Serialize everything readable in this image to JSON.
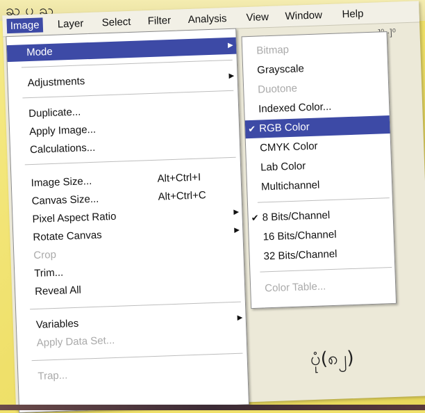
{
  "menubar": {
    "items": [
      "Image",
      "Layer",
      "Select",
      "Filter",
      "Analysis",
      "View",
      "Window",
      "Help"
    ]
  },
  "toolbar": {
    "glyphs": "]⁰ ·]⁰"
  },
  "image_menu": {
    "items": [
      {
        "label": "Mode",
        "submenu": true,
        "highlighted": true
      },
      {
        "label": "Adjustments",
        "submenu": true
      },
      {
        "label": "Duplicate..."
      },
      {
        "label": "Apply Image..."
      },
      {
        "label": "Calculations..."
      },
      {
        "label": "Image Size...",
        "shortcut": "Alt+Ctrl+I"
      },
      {
        "label": "Canvas Size...",
        "shortcut": "Alt+Ctrl+C"
      },
      {
        "label": "Pixel Aspect Ratio",
        "submenu": true
      },
      {
        "label": "Rotate Canvas",
        "submenu": true
      },
      {
        "label": "Crop",
        "disabled": true
      },
      {
        "label": "Trim..."
      },
      {
        "label": "Reveal All"
      },
      {
        "label": "Variables",
        "submenu": true
      },
      {
        "label": "Apply Data Set...",
        "disabled": true
      },
      {
        "label": "Trap...",
        "disabled": true
      }
    ]
  },
  "mode_menu": {
    "items": [
      {
        "label": "Bitmap",
        "disabled": true
      },
      {
        "label": "Grayscale"
      },
      {
        "label": "Duotone",
        "disabled": true
      },
      {
        "label": "Indexed Color..."
      },
      {
        "label": "RGB Color",
        "checked": true,
        "highlighted": true
      },
      {
        "label": "CMYK Color"
      },
      {
        "label": "Lab Color"
      },
      {
        "label": "Multichannel"
      },
      {
        "label": "8 Bits/Channel",
        "checked": true
      },
      {
        "label": "16 Bits/Channel"
      },
      {
        "label": "32 Bits/Channel"
      },
      {
        "label": "Color Table...",
        "disabled": true
      }
    ]
  },
  "caption": "ပုံ(၈၂)",
  "colors": {
    "highlight": "#3d4aa6",
    "paper": "#efe06a"
  }
}
